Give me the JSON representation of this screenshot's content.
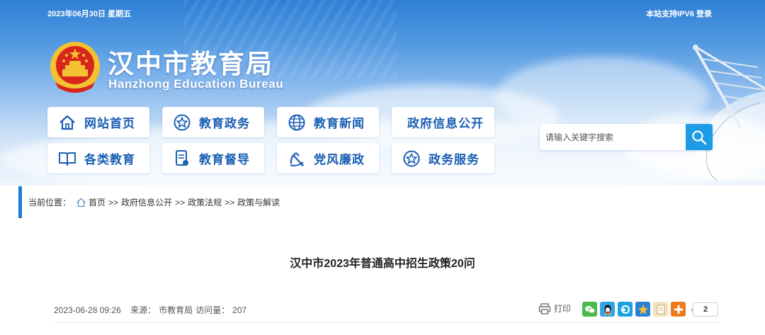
{
  "header": {
    "date": "2023年06月30日 星期五",
    "top_links": "本站支持IPV6 登录",
    "site_title": "汉中市教育局",
    "site_subtitle": "Hanzhong Education Bureau"
  },
  "nav": {
    "row1": [
      {
        "label": "网站首页",
        "icon": "home-icon"
      },
      {
        "label": "教育政务",
        "icon": "star-badge-icon"
      },
      {
        "label": "教育新闻",
        "icon": "globe-icon"
      },
      {
        "label": "政府信息公开",
        "icon": ""
      }
    ],
    "row2": [
      {
        "label": "各类教育",
        "icon": "book-icon"
      },
      {
        "label": "教育督导",
        "icon": "document-icon"
      },
      {
        "label": "党风廉政",
        "icon": "party-emblem-icon"
      },
      {
        "label": "政务服务",
        "icon": "star-badge-icon"
      }
    ]
  },
  "search": {
    "placeholder": "请输入关键字搜索",
    "button_icon": "search-icon"
  },
  "breadcrumb": {
    "label": "当前位置：",
    "items": [
      "首页",
      "政府信息公开",
      "政策法规",
      "政策与解读"
    ],
    "separator": ">>"
  },
  "article": {
    "title": "汉中市2023年普通高中招生政策20问",
    "datetime": "2023-06-28 09:26",
    "source_label": "来源：",
    "source": "市教育局",
    "views_label": "访问量：",
    "views": "207",
    "print_label": "打印",
    "share_icons": [
      "wechat-icon",
      "qq-icon",
      "qzone-icon",
      "favorite-star-icon",
      "copy-icon",
      "more-icon"
    ],
    "share_count": "2"
  },
  "colors": {
    "brand_blue": "#1a5fb4",
    "accent_blue": "#1d9be6",
    "banner_top": "#2f7fd6"
  }
}
